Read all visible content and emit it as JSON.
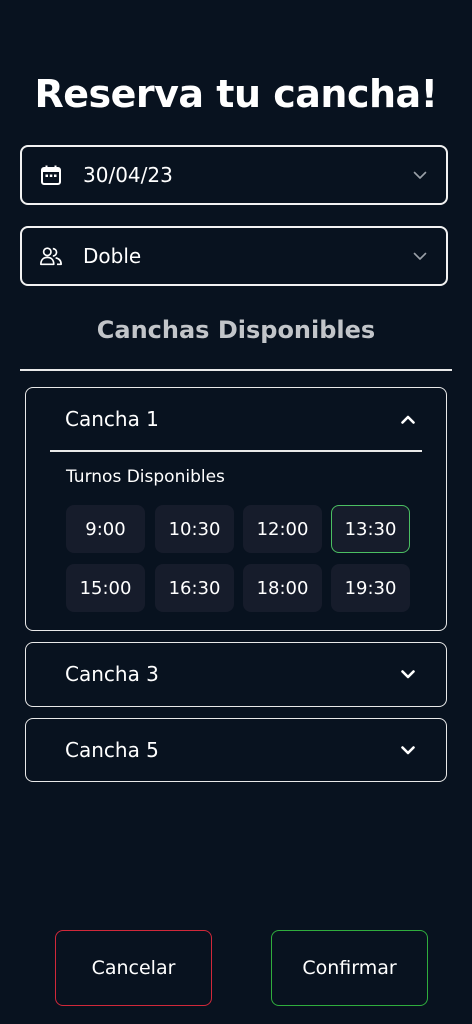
{
  "page": {
    "title": "Reserva tu cancha!",
    "subtitle": "Canchas Disponibles"
  },
  "date_select": {
    "icon": "calendar-icon",
    "value": "30/04/23"
  },
  "mode_select": {
    "icon": "users-icon",
    "value": "Doble"
  },
  "courts": [
    {
      "label": "Cancha 1",
      "expanded": true,
      "turnos_label": "Turnos Disponibles",
      "slots": [
        "9:00",
        "10:30",
        "12:00",
        "13:30",
        "15:00",
        "16:30",
        "18:00",
        "19:30"
      ],
      "selected_slot": "13:30"
    },
    {
      "label": "Cancha 3",
      "expanded": false
    },
    {
      "label": "Cancha 5",
      "expanded": false
    }
  ],
  "actions": {
    "cancel_label": "Cancelar",
    "confirm_label": "Confirmar"
  },
  "colors": {
    "background": "#08121f",
    "slot_bg": "#161c2b",
    "selected_border": "#4bbf62",
    "cancel_border": "#d1283a",
    "confirm_border": "#2fad3d"
  }
}
